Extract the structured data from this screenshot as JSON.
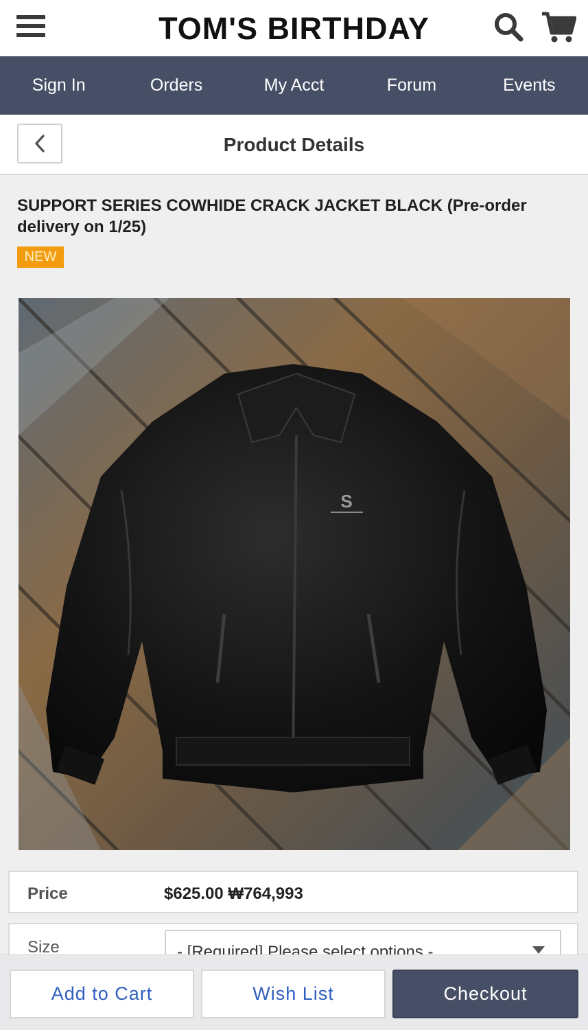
{
  "header": {
    "brand": "TOM'S BIRTHDAY",
    "icons": [
      "menu-icon",
      "search-icon",
      "cart-icon"
    ]
  },
  "nav": {
    "items": [
      "Sign In",
      "Orders",
      "My Acct",
      "Forum",
      "Events"
    ]
  },
  "subheader": {
    "title": "Product Details",
    "back_icon": "chevron-left-icon"
  },
  "product": {
    "title": "SUPPORT SERIES COWHIDE CRACK JACKET BLACK (Pre-order delivery on 1/25)",
    "badge": "NEW",
    "image_description_icon": "leather-jacket-photo"
  },
  "info": {
    "price_label": "Price",
    "price_value": "$625.00 ₩764,993",
    "size_label": "Size",
    "size_select_value": "- [Required] Please select options -"
  },
  "actions": {
    "add_to_cart": "Add to Cart",
    "wish_list": "Wish List",
    "checkout": "Checkout"
  },
  "colors": {
    "nav_background": "#474f66",
    "badge": "#f39c12",
    "link_blue": "#2f5fc0",
    "checkout_background": "#474f66"
  }
}
